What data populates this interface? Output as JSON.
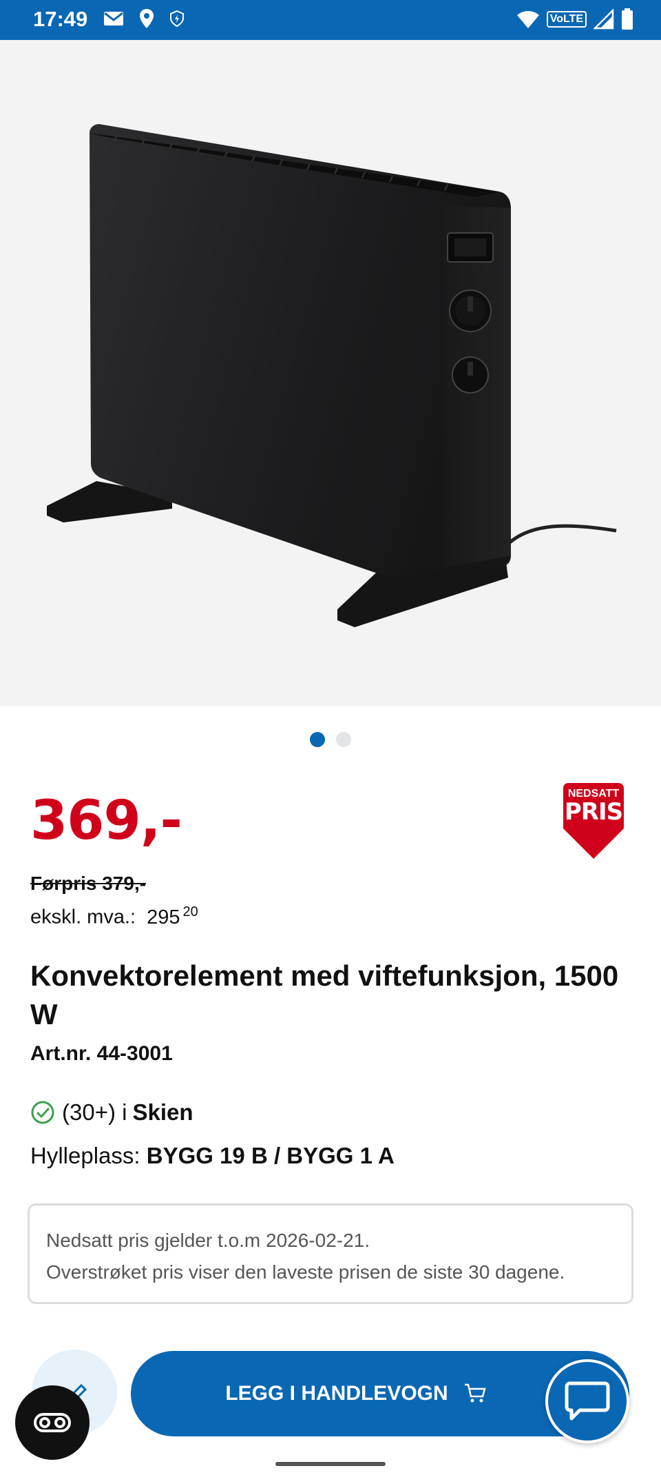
{
  "status_bar": {
    "time": "17:49",
    "left_icons": [
      "mail-icon",
      "location-icon",
      "shield-icon"
    ],
    "right_icons": [
      "wifi-icon",
      "volte-icon",
      "signal-icon",
      "battery-icon"
    ],
    "volte_label": "VoLTE"
  },
  "product": {
    "image_alt": "convector-heater-image",
    "carousel": {
      "count": 2,
      "active": 1
    },
    "price": "369,-",
    "badge": {
      "line1": "NEDSATT",
      "line2": "PRIS"
    },
    "before_price": "Førpris 379,-",
    "excl_vat": {
      "label": "ekskl. mva.:",
      "value": "295",
      "decimals": "20"
    },
    "title": "Konvektorelement med viftefunksjon, 1500 W",
    "art_nr": "Art.nr. 44-3001",
    "stock": {
      "count": "(30+)",
      "preposition": "i",
      "store": "Skien"
    },
    "shelf": {
      "label": "Hylleplass:",
      "value": "BYGG 19 B / BYGG 1 A"
    },
    "notice": {
      "line1": "Nedsatt pris gjelder t.o.m 2026-02-21.",
      "line2": "Overstrøket pris viser den laveste prisen de siste 30 dagene."
    }
  },
  "actions": {
    "add_to_cart_label": "LEGG I HANDLEVOGN"
  },
  "colors": {
    "brand_blue": "#0a67b3",
    "price_red": "#d0021b",
    "stock_green": "#3aa04a"
  }
}
